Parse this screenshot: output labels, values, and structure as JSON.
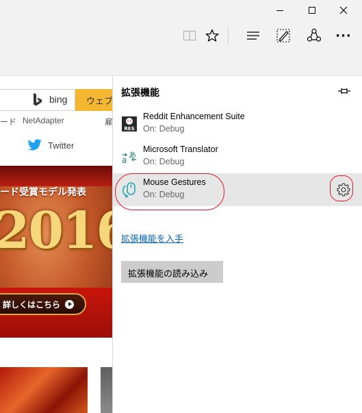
{
  "window_controls": [
    "minimize",
    "maximize",
    "close"
  ],
  "toolbar": {
    "icons": [
      "reading-view-icon",
      "favorites-star-icon",
      "hub-icon",
      "web-note-icon",
      "share-icon",
      "more-icon"
    ],
    "more_label": "···"
  },
  "page": {
    "search_engine": "bing",
    "search_button_label": "ウェブ",
    "links": [
      "ード",
      "NetAdapter",
      "雇"
    ],
    "twitter_label": "Twitter",
    "banner_headline": "ード受賞モデル発表",
    "banner_year": "2016",
    "banner_button": "詳しくはこちら"
  },
  "panel": {
    "title": "拡張機能",
    "extensions": [
      {
        "name": "Reddit Enhancement Suite",
        "status": "On: Debug",
        "icon": "res-icon"
      },
      {
        "name": "Microsoft Translator",
        "status": "On: Debug",
        "icon": "translator-icon"
      },
      {
        "name": "Mouse Gestures",
        "status": "On: Debug",
        "icon": "mouse-icon",
        "selected": true
      }
    ],
    "get_extensions_link": "拡張機能を入手",
    "load_extension_button": "拡張機能の読み込み"
  },
  "colors": {
    "accent_link": "#0063b1",
    "annotation_red": "#e0162b",
    "search_button": "#f5b731"
  }
}
